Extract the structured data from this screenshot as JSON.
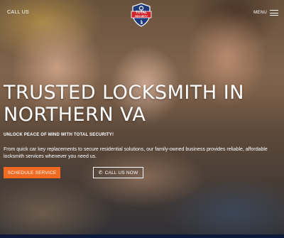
{
  "header": {
    "call_us_label": "CALL US",
    "logo_text_line1": "TOTAL",
    "logo_text_line2": "SECURITY",
    "menu_label": "MENU"
  },
  "hero": {
    "headline_line1": "TRUSTED LOCKSMITH IN",
    "headline_line2": "NORTHERN VA",
    "subheadline": "UNLOCK PEACE OF MIND WITH TOTAL SECURITY!",
    "body": "From quick car key replacements to secure residential solutions, our family-owned business provides reliable, affordable locksmith services whenever you need us.",
    "schedule_button": "SCHEDULE SERVICE",
    "call_button": "CALL US NOW"
  },
  "icons": {
    "menu": "hamburger-icon",
    "call": "phone-icon",
    "logo": "shield-key-logo"
  },
  "colors": {
    "accent": "#f26a21",
    "logo_blue": "#1e3a7a",
    "logo_red": "#d2232a",
    "footer_bar": "#0f1a3a"
  }
}
